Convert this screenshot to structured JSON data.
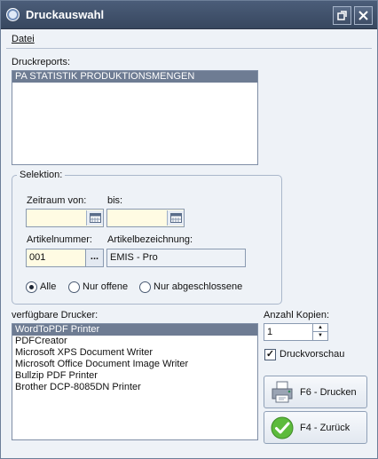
{
  "window": {
    "title": "Druckauswahl"
  },
  "menu": {
    "file": "Datei"
  },
  "reports": {
    "label": "Druckreports:",
    "items": [
      "PA STATISTIK PRODUKTIONSMENGEN"
    ]
  },
  "selection": {
    "title": "Selektion:",
    "from_label": "Zeitraum von:",
    "to_label": "bis:",
    "from_value": "",
    "to_value": "",
    "article_no_label": "Artikelnummer:",
    "article_no_value": "001",
    "article_desc_label": "Artikelbezeichnung:",
    "article_desc_value": "EMIS - Pro",
    "lookup_label": "...",
    "radio_all": "Alle",
    "radio_open": "Nur offene",
    "radio_closed": "Nur abgeschlossene"
  },
  "printers": {
    "label": "verfügbare Drucker:",
    "items": [
      "WordToPDF Printer",
      "PDFCreator",
      "Microsoft XPS Document Writer",
      "Microsoft Office Document Image Writer",
      "Bullzip PDF Printer",
      "Brother DCP-8085DN Printer"
    ]
  },
  "copies": {
    "label": "Anzahl Kopien:",
    "value": "1"
  },
  "preview": {
    "label": "Druckvorschau",
    "checked": true
  },
  "buttons": {
    "print": "F6 - Drucken",
    "back": "F4 - Zurück"
  },
  "colors": {
    "titlebar": "#3f4f69",
    "selection": "#6e7c93",
    "input_bg": "#fffbe3"
  }
}
